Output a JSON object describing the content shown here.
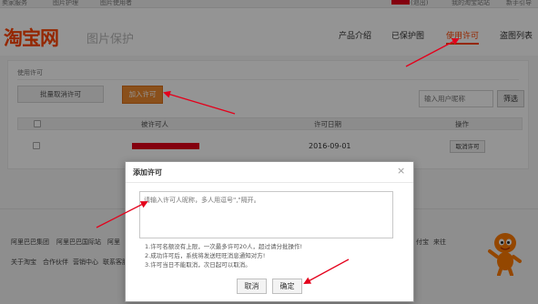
{
  "topbar": {
    "left1": "卖家服务",
    "left2": "图片护理",
    "left3": "图片使用者",
    "right1": "(退出)",
    "right2": "我的淘宝站站",
    "right3": "新手引导"
  },
  "header": {
    "logo": "淘宝网",
    "subtitle": "图片保护",
    "nav": [
      "产品介绍",
      "已保护图",
      "使用许可",
      "盗图列表"
    ],
    "active_nav": "使用许可"
  },
  "panel": {
    "title": "使用许可",
    "batch_cancel_label": "批量取消许可",
    "add_permit_label": "加入许可",
    "search_placeholder": "输入用户昵称",
    "filter_label": "筛选",
    "columns": [
      "被许可人",
      "许可日期",
      "操作"
    ],
    "rows": [
      {
        "licensee": "",
        "date": "2016-09-01",
        "action": "取消许可"
      }
    ]
  },
  "footer": {
    "row1": [
      "阿里巴巴集团",
      "阿里巴巴国际站",
      "阿里"
    ],
    "row1_right": [
      "付宝",
      "来往"
    ],
    "row2": [
      "关于淘宝",
      "合作伙伴",
      "营销中心",
      "联系客服"
    ]
  },
  "modal": {
    "title": "添加许可",
    "close_glyph": "×",
    "textarea_placeholder": "请输入许可人昵称，多人用逗号\",\"隔开。",
    "rules": [
      "1.许可名额没有上限，一次最多许可20人，超过请分批操作!",
      "2.成功许可后，系统将发送旺旺消息通知对方!",
      "3.许可当日不能取消，次日起可以取消。"
    ],
    "cancel_label": "取消",
    "confirm_label": "确定"
  },
  "colors": {
    "brand": "#ff4400",
    "add_button": "#ee8b2f",
    "annotation_red": "#e4001b"
  },
  "icons": [
    "close-icon",
    "mascot-icon"
  ]
}
